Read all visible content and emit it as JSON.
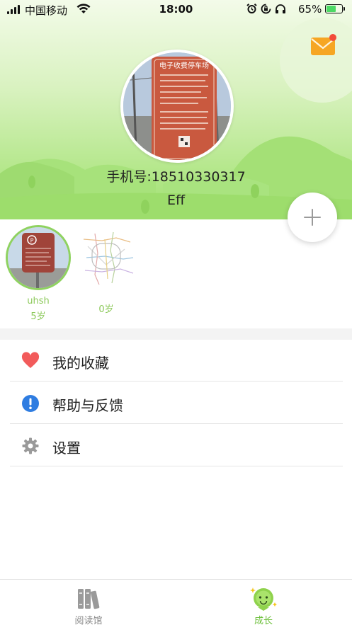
{
  "status_bar": {
    "carrier": "中国移动",
    "time": "18:00",
    "battery": "65%",
    "battery_level": 0.65
  },
  "header": {
    "phone": "手机号:18510330317",
    "nickname": "Eff",
    "avatar_sign_title": "电子收费停车场",
    "has_unread_mail": true
  },
  "children": [
    {
      "name": "uhsh",
      "age": "5岁"
    },
    {
      "name": "",
      "age": "0岁"
    }
  ],
  "menu": [
    {
      "label": "我的收藏",
      "icon": "heart-icon"
    },
    {
      "label": "帮助与反馈",
      "icon": "info-icon"
    },
    {
      "label": "设置",
      "icon": "gear-icon"
    }
  ],
  "tabs": [
    {
      "label": "阅读馆",
      "icon": "books-icon",
      "active": false
    },
    {
      "label": "成长",
      "icon": "growth-mascot-icon",
      "active": true
    }
  ],
  "colors": {
    "accent_green": "#8cc95a",
    "header_green": "#9ee06f",
    "heart_red": "#f25b5b",
    "info_blue": "#2f7de1",
    "mail_orange": "#f6a623"
  }
}
